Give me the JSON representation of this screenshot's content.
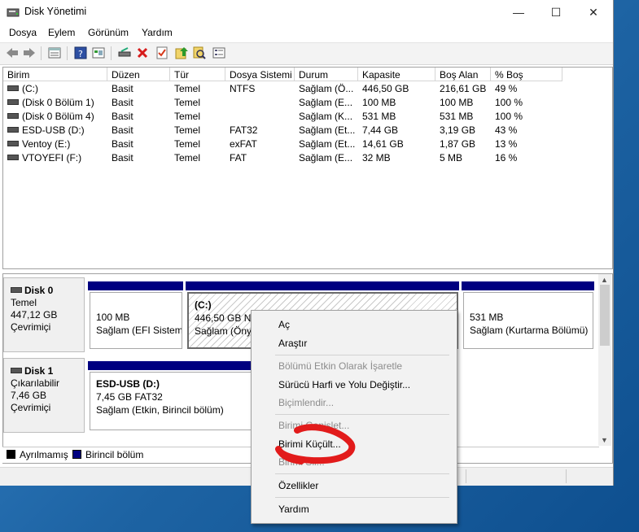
{
  "window": {
    "title": "Disk Yönetimi",
    "controls": {
      "minimize": "—",
      "maximize": "☐",
      "close": "✕"
    }
  },
  "menubar": [
    "Dosya",
    "Eylem",
    "Görünüm",
    "Yardım"
  ],
  "toolbar_icons": [
    "back-icon",
    "forward-icon",
    "volume-list-icon",
    "help-icon",
    "properties-icon",
    "connect-drive-icon",
    "delete-icon",
    "checklist-icon",
    "upload-icon",
    "search-icon",
    "list-view-icon"
  ],
  "volume_table": {
    "columns": [
      "Birim",
      "Düzen",
      "Tür",
      "Dosya Sistemi",
      "Durum",
      "Kapasite",
      "Boş Alan",
      "% Boş"
    ],
    "rows": [
      [
        "(C:)",
        "Basit",
        "Temel",
        "NTFS",
        "Sağlam (Ö...",
        "446,50 GB",
        "216,61 GB",
        "49 %"
      ],
      [
        "(Disk 0 Bölüm 1)",
        "Basit",
        "Temel",
        "",
        "Sağlam (E...",
        "100 MB",
        "100 MB",
        "100 %"
      ],
      [
        "(Disk 0 Bölüm 4)",
        "Basit",
        "Temel",
        "",
        "Sağlam (K...",
        "531 MB",
        "531 MB",
        "100 %"
      ],
      [
        "ESD-USB (D:)",
        "Basit",
        "Temel",
        "FAT32",
        "Sağlam (Et...",
        "7,44 GB",
        "3,19 GB",
        "43 %"
      ],
      [
        "Ventoy (E:)",
        "Basit",
        "Temel",
        "exFAT",
        "Sağlam (Et...",
        "14,61 GB",
        "1,87 GB",
        "13 %"
      ],
      [
        "VTOYEFI (F:)",
        "Basit",
        "Temel",
        "FAT",
        "Sağlam (E...",
        "32 MB",
        "5 MB",
        "16 %"
      ]
    ]
  },
  "disks": [
    {
      "name": "Disk 0",
      "type": "Temel",
      "size": "447,12 GB",
      "status": "Çevrimiçi",
      "partitions": [
        {
          "title": "",
          "size": "100 MB",
          "status": "Sağlam (EFI Sistem B"
        },
        {
          "title": "(C:)",
          "size": "446,50 GB NTFS",
          "status": "Sağlam (Önyü"
        },
        {
          "title": "",
          "size": "531 MB",
          "status": "Sağlam (Kurtarma Bölümü)"
        }
      ]
    },
    {
      "name": "Disk 1",
      "type": "Çıkarılabilir",
      "size": "7,46 GB",
      "status": "Çevrimiçi",
      "partitions": [
        {
          "title": "ESD-USB  (D:)",
          "size": "7,45 GB FAT32",
          "status": "Sağlam (Etkin, Birincil bölüm)"
        }
      ]
    }
  ],
  "legend": [
    {
      "label": "Ayrılmamış",
      "color": "#000000"
    },
    {
      "label": "Birincil bölüm",
      "color": "#000080"
    }
  ],
  "context_menu": {
    "items": [
      {
        "label": "Aç",
        "enabled": true
      },
      {
        "label": "Araştır",
        "enabled": true
      },
      {
        "label": "Bölümü Etkin Olarak İşaretle",
        "enabled": false
      },
      {
        "label": "Sürücü Harfi ve Yolu Değiştir...",
        "enabled": true
      },
      {
        "label": "Biçimlendir...",
        "enabled": false
      },
      {
        "label": "Birimi Genişlet...",
        "enabled": false
      },
      {
        "label": "Birimi Küçült...",
        "enabled": true
      },
      {
        "label": "Birimi Sil...",
        "enabled": false
      },
      {
        "label": "Özellikler",
        "enabled": true
      },
      {
        "label": "Yardım",
        "enabled": true
      }
    ]
  },
  "annotation_color": "#e21b1b"
}
